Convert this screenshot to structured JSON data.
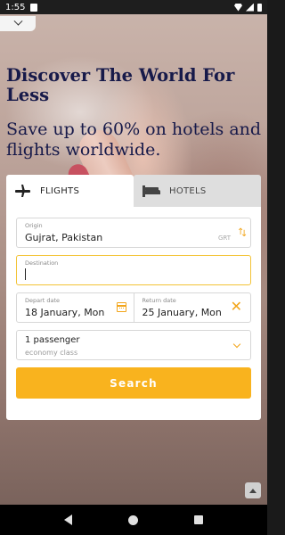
{
  "status_bar": {
    "time": "1:55"
  },
  "hero": {
    "headline": "Discover The World For Less",
    "subheadline": "Save up to 60% on hotels and flights worldwide."
  },
  "tabs": [
    {
      "label": "FLIGHTS",
      "icon": "plane-icon",
      "active": true
    },
    {
      "label": "HOTELS",
      "icon": "bed-icon",
      "active": false
    }
  ],
  "form": {
    "origin": {
      "label": "Origin",
      "value": "Gujrat, Pakistan",
      "code": "GRT"
    },
    "destination": {
      "label": "Destination",
      "value": ""
    },
    "depart": {
      "label": "Depart date",
      "value": "18 January, Mon"
    },
    "return": {
      "label": "Return date",
      "value": "25 January, Mon"
    },
    "passengers": {
      "count": "1 passenger",
      "class": "economy class"
    },
    "search_label": "Search"
  },
  "colors": {
    "accent": "#f9b31e",
    "headline": "#171a4a"
  }
}
